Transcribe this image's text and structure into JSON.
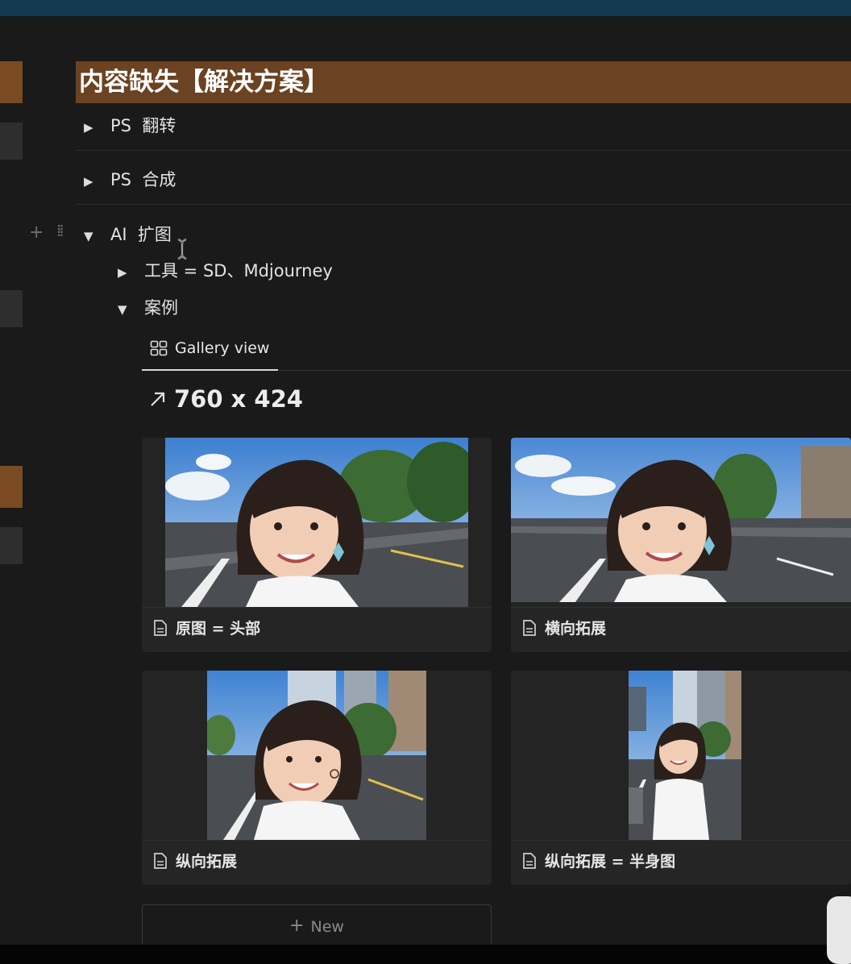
{
  "page": {
    "heading": "内容缺失【解决方案】",
    "toggles": [
      {
        "label": "PS  翻转",
        "state": "collapsed"
      },
      {
        "label": "PS  合成",
        "state": "collapsed"
      },
      {
        "label": "AI  扩图",
        "state": "expanded"
      }
    ],
    "subtoggles": [
      {
        "label": "工具 = SD、Mdjourney",
        "state": "collapsed"
      },
      {
        "label": "案例",
        "state": "expanded"
      }
    ]
  },
  "gallery": {
    "tab_label": "Gallery view",
    "size_label": "760 x 424",
    "new_label": "New",
    "cards": [
      {
        "title": "原图 = 头部"
      },
      {
        "title": "横向拓展"
      },
      {
        "title": "纵向拓展"
      },
      {
        "title": "纵向拓展 = 半身图"
      }
    ]
  },
  "colors": {
    "heading_bg": "#6b4222",
    "topbar": "#143a52",
    "background": "#1a1a1a"
  }
}
